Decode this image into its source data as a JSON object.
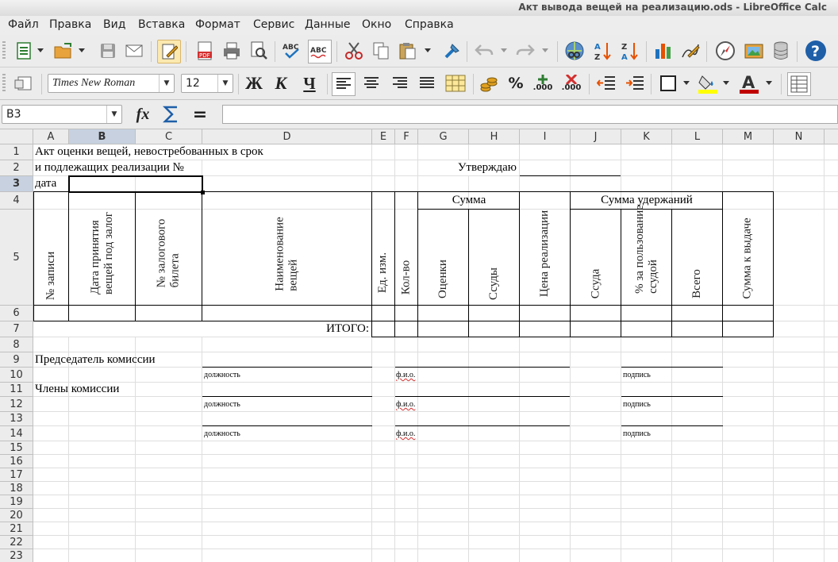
{
  "window": {
    "title": "Акт вывода вещей на реализацию.ods - LibreOffice Calc"
  },
  "menu": [
    "Файл",
    "Правка",
    "Вид",
    "Вставка",
    "Формат",
    "Сервис",
    "Данные",
    "Окно",
    "Справка"
  ],
  "formatting": {
    "font_name": "Times New Roman",
    "font_size": "12",
    "bold": "Ж",
    "italic": "К",
    "underline": "Ч",
    "percent": "%",
    "add_decimal": ".000",
    "del_decimal": ".000"
  },
  "formula_bar": {
    "name_box": "B3",
    "fx": "fx",
    "equals": "=",
    "content": ""
  },
  "columns": [
    "A",
    "B",
    "C",
    "D",
    "E",
    "F",
    "G",
    "H",
    "I",
    "J",
    "K",
    "L",
    "M",
    "N"
  ],
  "rows": [
    "1",
    "2",
    "3",
    "4",
    "5",
    "6",
    "7",
    "8",
    "9",
    "10",
    "11",
    "12",
    "13",
    "14",
    "15",
    "16",
    "17",
    "18",
    "19",
    "20",
    "21",
    "22",
    "23"
  ],
  "selected_cell": {
    "col": "B",
    "row": "3"
  },
  "cells": {
    "a1": "Акт оценки вещей, невостребованных в срок",
    "a2": "и подлежащих реализации №",
    "a3": "дата",
    "approve": "Утверждаю",
    "h_record": "№ записи",
    "h_date": "Дата принятия\nвещей под залог",
    "h_ticket": "№ залогового\nбилета",
    "h_name": "Наименование\nвещей",
    "h_unit": "Ед. изм.",
    "h_qty": "Кол-во",
    "h_sum": "Сумма",
    "h_eval": "Оценки",
    "h_loan": "Ссуды",
    "h_price": "Цена реализации",
    "h_withhold": "Сумма удержаний",
    "h_w_loan": "Ссуда",
    "h_w_pct": "% за пользование\nссудой",
    "h_w_total": "Всего",
    "h_payout": "Сумма к выдаче",
    "total": "ИТОГО:",
    "chairman": "Председатель комиссии",
    "members": "Члены комиссии",
    "position": "должность",
    "fio": "ф.и.о.",
    "signature": "подпись"
  }
}
